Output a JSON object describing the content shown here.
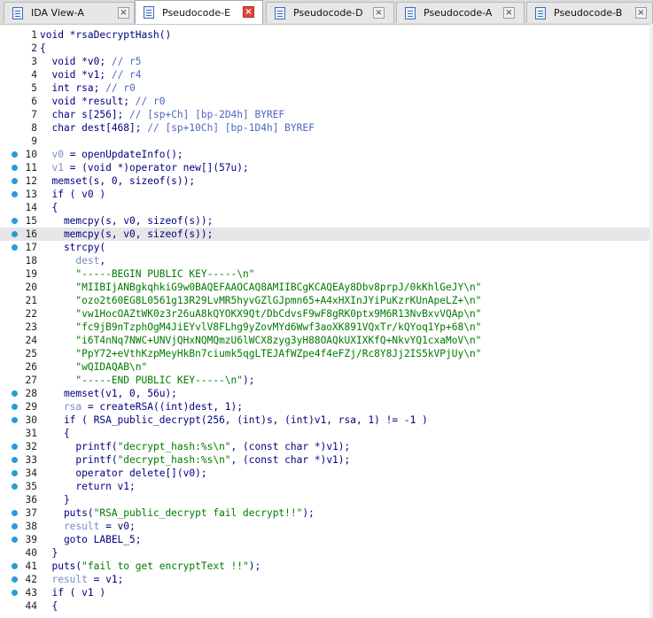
{
  "tabs": [
    {
      "label": "IDA View-A",
      "active": false
    },
    {
      "label": "Pseudocode-E",
      "active": true
    },
    {
      "label": "Pseudocode-D",
      "active": false
    },
    {
      "label": "Pseudocode-A",
      "active": false
    },
    {
      "label": "Pseudocode-B",
      "active": false
    }
  ],
  "tab_close_glyph": "×",
  "colors": {
    "keyword": "#000080",
    "comment": "#4d68c2",
    "string": "#007a00",
    "breakpoint": "#2a9ad8",
    "current_line_bg": "#e6e6e6",
    "active_tab_close": "#e0463a"
  },
  "code": {
    "current_line": 16,
    "lines": [
      {
        "n": "1",
        "bp": false,
        "tokens": [
          [
            "plain",
            "void *rsaDecryptHash()"
          ]
        ]
      },
      {
        "n": "2",
        "bp": false,
        "tokens": [
          [
            "plain",
            "{"
          ]
        ]
      },
      {
        "n": "3",
        "bp": false,
        "tokens": [
          [
            "plain",
            "  void *v0; "
          ],
          [
            "comment",
            "// r5"
          ]
        ]
      },
      {
        "n": "4",
        "bp": false,
        "tokens": [
          [
            "plain",
            "  void *v1; "
          ],
          [
            "comment",
            "// r4"
          ]
        ]
      },
      {
        "n": "5",
        "bp": false,
        "tokens": [
          [
            "plain",
            "  int rsa; "
          ],
          [
            "comment",
            "// r0"
          ]
        ]
      },
      {
        "n": "6",
        "bp": false,
        "tokens": [
          [
            "plain",
            "  void *result; "
          ],
          [
            "comment",
            "// r0"
          ]
        ]
      },
      {
        "n": "7",
        "bp": false,
        "tokens": [
          [
            "plain",
            "  char s[256]; "
          ],
          [
            "comment",
            "// [sp+Ch] [bp-2D4h] BYREF"
          ]
        ]
      },
      {
        "n": "8",
        "bp": false,
        "tokens": [
          [
            "plain",
            "  char dest[468]; "
          ],
          [
            "comment",
            "// [sp+10Ch] [bp-1D4h] BYREF"
          ]
        ]
      },
      {
        "n": "9",
        "bp": false,
        "tokens": []
      },
      {
        "n": "10",
        "bp": true,
        "tokens": [
          [
            "dim",
            "  v0"
          ],
          [
            "plain",
            " = openUpdateInfo();"
          ]
        ]
      },
      {
        "n": "11",
        "bp": true,
        "tokens": [
          [
            "dim",
            "  v1"
          ],
          [
            "plain",
            " = (void *)operator new[](57u);"
          ]
        ]
      },
      {
        "n": "12",
        "bp": true,
        "tokens": [
          [
            "plain",
            "  memset(s, 0, sizeof(s));"
          ]
        ]
      },
      {
        "n": "13",
        "bp": true,
        "tokens": [
          [
            "plain",
            "  if ( v0 )"
          ]
        ]
      },
      {
        "n": "14",
        "bp": false,
        "tokens": [
          [
            "plain",
            "  {"
          ]
        ]
      },
      {
        "n": "15",
        "bp": true,
        "tokens": [
          [
            "plain",
            "    memcpy(s, v0, sizeof(s));"
          ]
        ]
      },
      {
        "n": "16",
        "bp": true,
        "tokens": [
          [
            "plain",
            "    memcpy(s, v0, sizeof(s));"
          ]
        ]
      },
      {
        "n": "17",
        "bp": true,
        "tokens": [
          [
            "plain",
            "    strcpy("
          ]
        ]
      },
      {
        "n": "18",
        "bp": false,
        "tokens": [
          [
            "dim",
            "      dest"
          ],
          [
            "plain",
            ","
          ]
        ]
      },
      {
        "n": "19",
        "bp": false,
        "tokens": [
          [
            "str",
            "      \"-----BEGIN PUBLIC KEY-----\\n\""
          ]
        ]
      },
      {
        "n": "20",
        "bp": false,
        "tokens": [
          [
            "str",
            "      \"MIIBIjANBgkqhkiG9w0BAQEFAAOCAQ8AMIIBCgKCAQEAy8Dbv8prpJ/0kKhlGeJY\\n\""
          ]
        ]
      },
      {
        "n": "21",
        "bp": false,
        "tokens": [
          [
            "str",
            "      \"ozo2t60EG8L0561g13R29LvMR5hyvGZlGJpmn65+A4xHXInJYiPuKzrKUnApeLZ+\\n\""
          ]
        ]
      },
      {
        "n": "22",
        "bp": false,
        "tokens": [
          [
            "str",
            "      \"vw1HocOAZtWK0z3r26uA8kQYOKX9Qt/DbCdvsF9wF8gRK0ptx9M6R13NvBxvVQAp\\n\""
          ]
        ]
      },
      {
        "n": "23",
        "bp": false,
        "tokens": [
          [
            "str",
            "      \"fc9jB9nTzphOgM4JiEYvlV8FLhg9yZovMYd6Wwf3aoXK891VQxTr/kQYoq1Yp+68\\n\""
          ]
        ]
      },
      {
        "n": "24",
        "bp": false,
        "tokens": [
          [
            "str",
            "      \"i6T4nNq7NWC+UNVjQHxNQMQmzU6lWCX8zyg3yH88OAQkUXIXKfQ+NkvYQ1cxaMoV\\n\""
          ]
        ]
      },
      {
        "n": "25",
        "bp": false,
        "tokens": [
          [
            "str",
            "      \"PpY72+eVthKzpMeyHkBn7ciumk5qgLTEJAfWZpe4f4eFZj/Rc8Y8Jj2IS5kVPjUy\\n\""
          ]
        ]
      },
      {
        "n": "26",
        "bp": false,
        "tokens": [
          [
            "str",
            "      \"wQIDAQAB\\n\""
          ]
        ]
      },
      {
        "n": "27",
        "bp": false,
        "tokens": [
          [
            "str",
            "      \"-----END PUBLIC KEY-----\\n\""
          ],
          [
            "plain",
            ");"
          ]
        ]
      },
      {
        "n": "28",
        "bp": true,
        "tokens": [
          [
            "plain",
            "    memset(v1, 0, 56u);"
          ]
        ]
      },
      {
        "n": "29",
        "bp": true,
        "tokens": [
          [
            "dim",
            "    rsa"
          ],
          [
            "plain",
            " = createRSA((int)dest, 1);"
          ]
        ]
      },
      {
        "n": "30",
        "bp": true,
        "tokens": [
          [
            "plain",
            "    if ( RSA_public_decrypt(256, (int)s, (int)v1, rsa, 1) != -1 )"
          ]
        ]
      },
      {
        "n": "31",
        "bp": false,
        "tokens": [
          [
            "plain",
            "    {"
          ]
        ]
      },
      {
        "n": "32",
        "bp": true,
        "tokens": [
          [
            "plain",
            "      printf("
          ],
          [
            "str",
            "\"decrypt_hash:%s\\n\""
          ],
          [
            "plain",
            ", (const char *)v1);"
          ]
        ]
      },
      {
        "n": "33",
        "bp": true,
        "tokens": [
          [
            "plain",
            "      printf("
          ],
          [
            "str",
            "\"decrypt_hash:%s\\n\""
          ],
          [
            "plain",
            ", (const char *)v1);"
          ]
        ]
      },
      {
        "n": "34",
        "bp": true,
        "tokens": [
          [
            "plain",
            "      operator delete[](v0);"
          ]
        ]
      },
      {
        "n": "35",
        "bp": true,
        "tokens": [
          [
            "plain",
            "      return v1;"
          ]
        ]
      },
      {
        "n": "36",
        "bp": false,
        "tokens": [
          [
            "plain",
            "    }"
          ]
        ]
      },
      {
        "n": "37",
        "bp": true,
        "tokens": [
          [
            "plain",
            "    puts("
          ],
          [
            "str",
            "\"RSA_public_decrypt fail decrypt!!\""
          ],
          [
            "plain",
            ");"
          ]
        ]
      },
      {
        "n": "38",
        "bp": true,
        "tokens": [
          [
            "dim",
            "    result"
          ],
          [
            "plain",
            " = v0;"
          ]
        ]
      },
      {
        "n": "39",
        "bp": true,
        "tokens": [
          [
            "plain",
            "    goto LABEL_5;"
          ]
        ]
      },
      {
        "n": "40",
        "bp": false,
        "tokens": [
          [
            "plain",
            "  }"
          ]
        ]
      },
      {
        "n": "41",
        "bp": true,
        "tokens": [
          [
            "plain",
            "  puts("
          ],
          [
            "str",
            "\"fail to get encryptText !!\""
          ],
          [
            "plain",
            ");"
          ]
        ]
      },
      {
        "n": "42",
        "bp": true,
        "tokens": [
          [
            "dim",
            "  result"
          ],
          [
            "plain",
            " = v1;"
          ]
        ]
      },
      {
        "n": "43",
        "bp": true,
        "tokens": [
          [
            "plain",
            "  if ( v1 )"
          ]
        ]
      },
      {
        "n": "44",
        "bp": false,
        "tokens": [
          [
            "plain",
            "  {"
          ]
        ]
      }
    ]
  }
}
